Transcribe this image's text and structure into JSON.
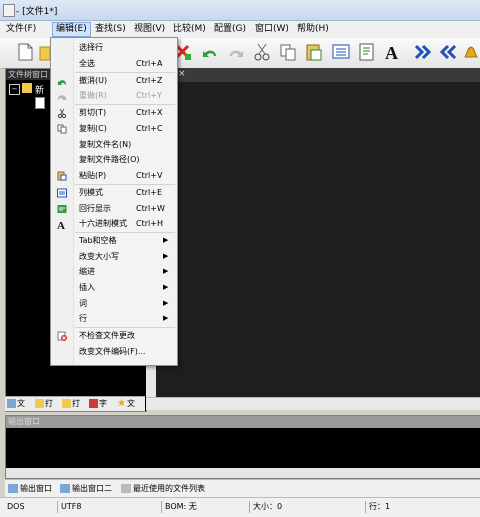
{
  "window": {
    "title": "- [文件1*]"
  },
  "menubar": [
    {
      "label": "文件(F)"
    },
    {
      "label": "编辑(E)"
    },
    {
      "label": "查找(S)"
    },
    {
      "label": "视图(V)"
    },
    {
      "label": "比较(M)"
    },
    {
      "label": "配置(G)"
    },
    {
      "label": "窗口(W)"
    },
    {
      "label": "帮助(H)"
    }
  ],
  "left_panel": {
    "header": "文件树窗口",
    "tree": [
      {
        "label": "新"
      }
    ]
  },
  "left_tabs": [
    {
      "label": "文"
    },
    {
      "label": "打"
    },
    {
      "label": "打"
    },
    {
      "label": "字"
    },
    {
      "label": "文"
    }
  ],
  "editor": {
    "tab_close": "×"
  },
  "output": {
    "header": "输出窗口"
  },
  "output_tabs": [
    {
      "label": "输出窗口"
    },
    {
      "label": "输出窗口二"
    },
    {
      "label": "最近使用的文件列表"
    }
  ],
  "statusbar": {
    "mode": "DOS",
    "encoding": "UTF8",
    "bom": "BOM: 无",
    "size": "大小：0",
    "line": "行：1"
  },
  "edit_menu": [
    {
      "label": "选择行",
      "shortcut": "",
      "submenu": false,
      "disabled": false,
      "icon": "none"
    },
    {
      "label": "全选",
      "shortcut": "Ctrl+A",
      "submenu": false,
      "disabled": false,
      "icon": "none",
      "sep_after": true
    },
    {
      "label": "撤消(U)",
      "shortcut": "Ctrl+Z",
      "submenu": false,
      "disabled": false,
      "icon": "undo-icon"
    },
    {
      "label": "重做(R)",
      "shortcut": "Ctrl+Y",
      "submenu": false,
      "disabled": true,
      "icon": "redo-icon",
      "sep_after": true
    },
    {
      "label": "剪切(T)",
      "shortcut": "Ctrl+X",
      "submenu": false,
      "disabled": false,
      "icon": "scissors-icon"
    },
    {
      "label": "复制(C)",
      "shortcut": "Ctrl+C",
      "submenu": false,
      "disabled": false,
      "icon": "copy-icon"
    },
    {
      "label": "复制文件名(N)",
      "shortcut": "",
      "submenu": false,
      "disabled": false,
      "icon": "none"
    },
    {
      "label": "复制文件路径(O)",
      "shortcut": "",
      "submenu": false,
      "disabled": false,
      "icon": "none"
    },
    {
      "label": "粘贴(P)",
      "shortcut": "Ctrl+V",
      "submenu": false,
      "disabled": false,
      "icon": "paste-icon",
      "sep_after": true
    },
    {
      "label": "列模式",
      "shortcut": "Ctrl+E",
      "submenu": false,
      "disabled": false,
      "icon": "column-mode-icon"
    },
    {
      "label": "回行显示",
      "shortcut": "Ctrl+W",
      "submenu": false,
      "disabled": false,
      "icon": "wrap-icon"
    },
    {
      "label": "十六进制模式",
      "shortcut": "Ctrl+H",
      "submenu": false,
      "disabled": false,
      "icon": "font-a-icon",
      "sep_after": true
    },
    {
      "label": "Tab和空格",
      "shortcut": "",
      "submenu": true,
      "disabled": false,
      "icon": "none"
    },
    {
      "label": "改变大小写",
      "shortcut": "",
      "submenu": true,
      "disabled": false,
      "icon": "none"
    },
    {
      "label": "缩进",
      "shortcut": "",
      "submenu": true,
      "disabled": false,
      "icon": "none"
    },
    {
      "label": "插入",
      "shortcut": "",
      "submenu": true,
      "disabled": false,
      "icon": "none"
    },
    {
      "label": "词",
      "shortcut": "",
      "submenu": true,
      "disabled": false,
      "icon": "none"
    },
    {
      "label": "行",
      "shortcut": "",
      "submenu": true,
      "disabled": false,
      "icon": "none",
      "sep_after": true
    },
    {
      "label": "不检查文件更改",
      "shortcut": "",
      "submenu": false,
      "disabled": false,
      "icon": "no-check-icon"
    },
    {
      "label": "改变文件编码(F)...",
      "shortcut": "",
      "submenu": false,
      "disabled": false,
      "icon": "none"
    }
  ],
  "colors": {
    "editor_bg": "#1e1e1e",
    "menu_highlight": "#cfe3fb",
    "accent_blue": "#1f4fb8"
  }
}
